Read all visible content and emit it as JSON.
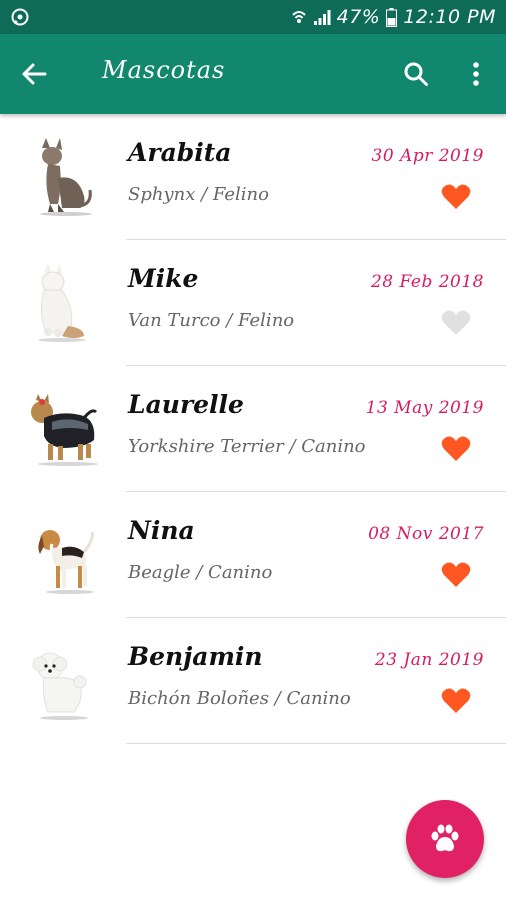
{
  "status_bar": {
    "battery": "47%",
    "time": "12:10 PM",
    "icons": [
      "whatsapp-icon",
      "wifi-icon",
      "signal-icon",
      "battery-icon"
    ]
  },
  "app_bar": {
    "title": "Mascotas",
    "icons": [
      "back-arrow-icon",
      "search-icon",
      "more-vert-icon"
    ]
  },
  "pets": [
    {
      "name": "Arabita",
      "breed": "Sphynx / Felino",
      "date": "30 Apr 2019",
      "favorite": true,
      "photo": "sphynx-cat"
    },
    {
      "name": "Mike",
      "breed": "Van Turco / Felino",
      "date": "28 Feb 2018",
      "favorite": false,
      "photo": "white-cat"
    },
    {
      "name": "Laurelle",
      "breed": "Yorkshire Terrier / Canino",
      "date": "13 May 2019",
      "favorite": true,
      "photo": "yorkshire-dog"
    },
    {
      "name": "Nina",
      "breed": "Beagle / Canino",
      "date": "08 Nov 2017",
      "favorite": true,
      "photo": "beagle-dog"
    },
    {
      "name": "Benjamin",
      "breed": "Bichón Boloñes / Canino",
      "date": "23 Jan 2019",
      "favorite": true,
      "photo": "bichon-dog"
    }
  ],
  "fab": {
    "icon": "paw-icon"
  },
  "colors": {
    "status_bar": "#0d6b58",
    "app_bar": "#11876d",
    "date": "#d81b60",
    "heart_active": "#ff5722",
    "heart_inactive": "#e0e0e0",
    "fab": "#e02265"
  }
}
